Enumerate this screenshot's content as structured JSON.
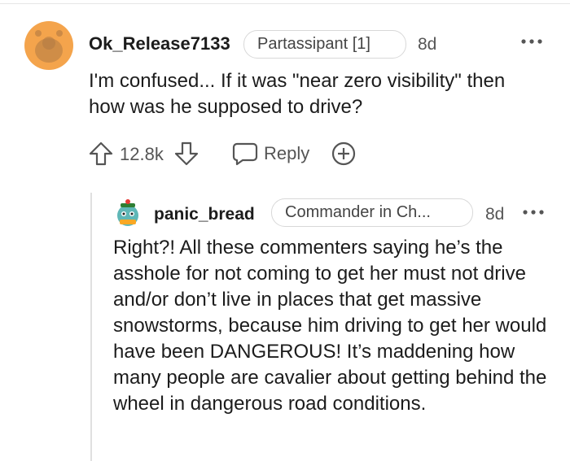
{
  "comment": {
    "username": "Ok_Release7133",
    "flair": "Partassipant [1]",
    "age": "8d",
    "more_icon": "more-horizontal-icon",
    "text": "I'm confused... If it was \"near zero visibility\" then how was he supposed to drive?",
    "votes": "12.8k",
    "reply_label": "Reply",
    "upvote_icon": "arrow-up-icon",
    "downvote_icon": "arrow-down-icon",
    "reply_icon": "speech-bubble-icon",
    "award_icon": "plus-circle-icon",
    "avatar_color": "#f4a44c"
  },
  "reply": {
    "username": "panic_bread",
    "flair": "Commander in Ch...",
    "age": "8d",
    "more_icon": "more-horizontal-icon",
    "text": "Right?! All these commenters saying he’s the asshole for not coming to get her must not drive and/or don’t live in places that get massive snowstorms, because him driving to get her would have been DANGEROUS! It’s maddening how many people are cavalier about getting behind the wheel in dangerous road conditions."
  }
}
